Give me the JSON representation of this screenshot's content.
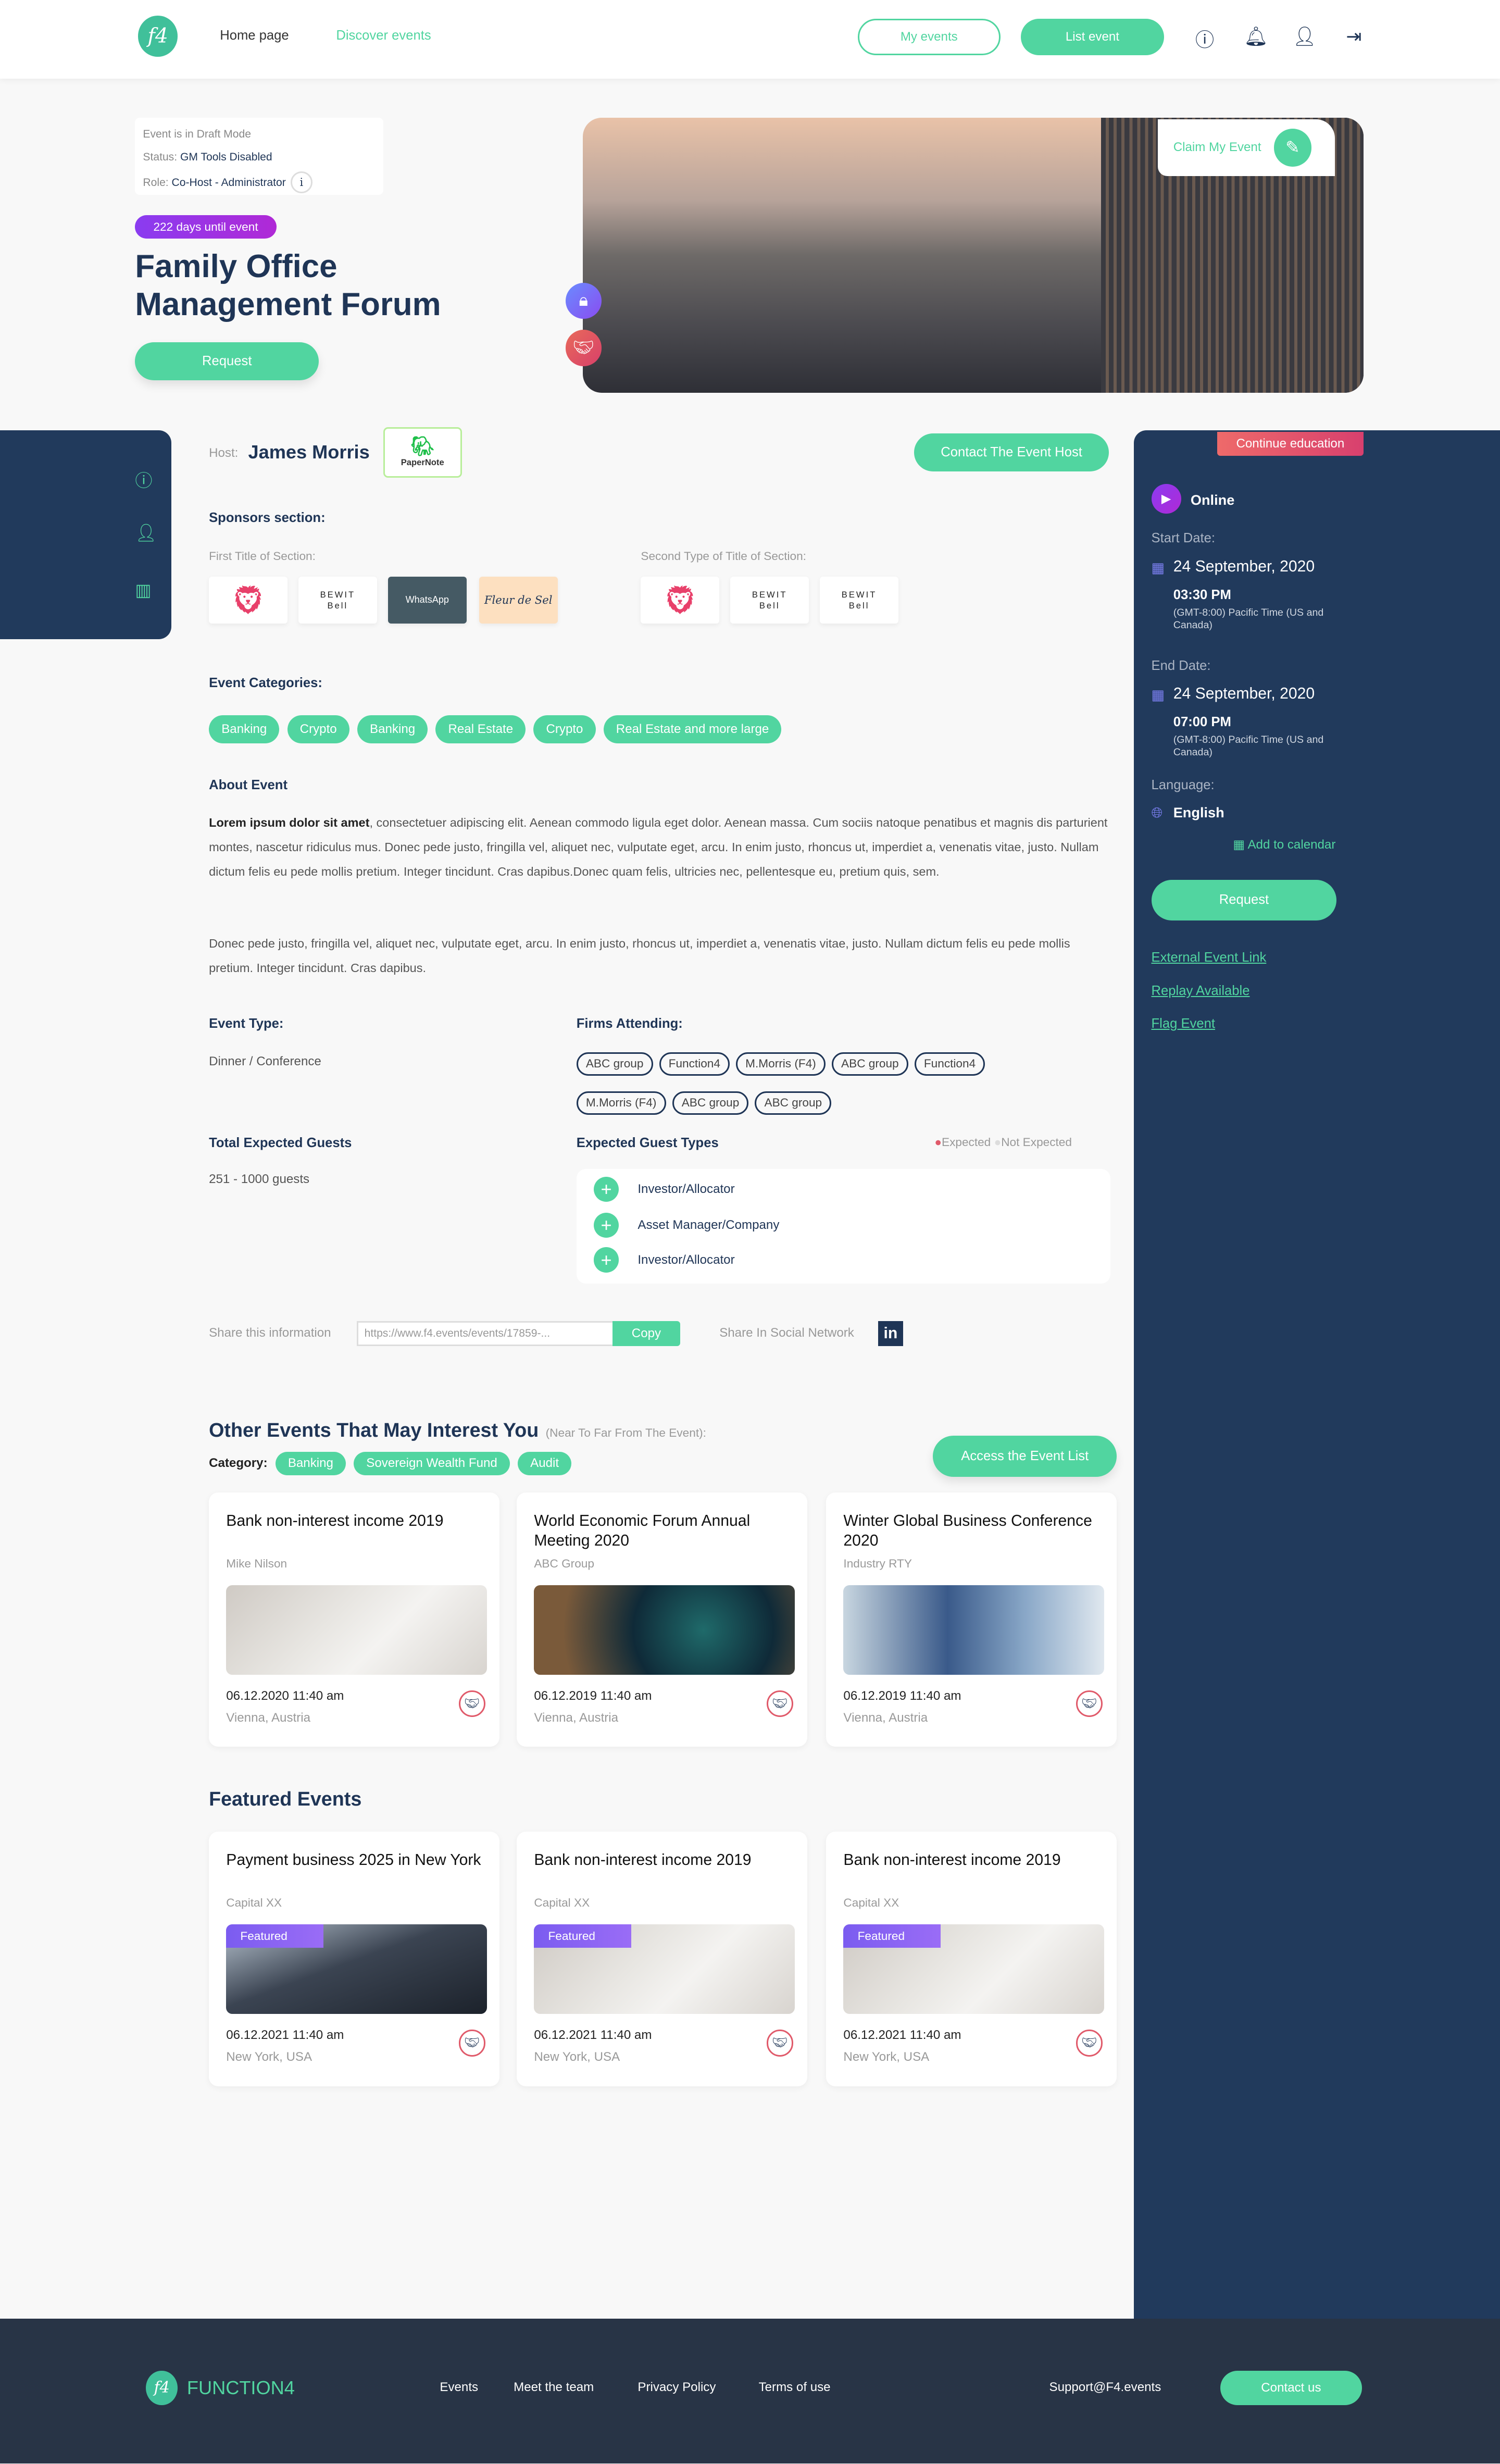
{
  "header": {
    "logo": "f4",
    "nav": [
      "Home page",
      "Discover events"
    ],
    "my_events": "My events",
    "list_event": "List event",
    "icons": [
      "info-icon",
      "bell-icon",
      "user-icon",
      "logout-icon"
    ]
  },
  "status": {
    "mode": "Event is in Draft Mode",
    "status_label": "Status:",
    "status_value": "GM Tools Disabled",
    "role_label": "Role:",
    "role_value": "Co-Host - Administrator",
    "info": "i"
  },
  "event": {
    "countdown": "222 days until event",
    "title_line1": "Family Office",
    "title_line2": "Management Forum",
    "request": "Request",
    "claim": "Claim My Event"
  },
  "host": {
    "label": "Host:",
    "name": "James Morris",
    "logo_text": "PaperNote",
    "contact": "Contact The Event Host"
  },
  "sponsors": {
    "title": "Sponsors section:",
    "first_title": "First Title of Section:",
    "second_title": "Second Type of Title of Section:",
    "first": [
      "Lion",
      "BEWIT Bell",
      "WhatsApp",
      "Fleur de Sel"
    ],
    "second": [
      "Lion",
      "BEWIT Bell",
      "BEWIT Bell"
    ]
  },
  "categories": {
    "title": "Event Categories:",
    "items": [
      "Banking",
      "Crypto",
      "Banking",
      "Real Estate",
      "Crypto",
      "Real Estate and more large"
    ]
  },
  "about": {
    "title": "About Event",
    "bold": "Lorem ipsum dolor sit amet",
    "p1": ", consectetuer adipiscing elit. Aenean commodo ligula eget dolor. Aenean massa. Cum sociis natoque penatibus et magnis dis parturient montes, nascetur ridiculus mus. Donec pede justo, fringilla vel, aliquet nec, vulputate eget, arcu. In enim justo, rhoncus ut, imperdiet a, venenatis vitae, justo. Nullam dictum felis eu pede mollis pretium. Integer tincidunt. Cras dapibus.Donec quam felis, ultricies nec, pellentesque eu, pretium quis, sem.",
    "p2": "Donec pede justo, fringilla vel, aliquet nec, vulputate eget, arcu. In enim justo, rhoncus ut, imperdiet a, venenatis vitae, justo. Nullam dictum felis eu pede mollis pretium. Integer tincidunt. Cras dapibus."
  },
  "details": {
    "type_title": "Event Type:",
    "type_value": "Dinner / Conference",
    "firms_title": "Firms Attending:",
    "firms": [
      "ABC group",
      "Function4",
      "M.Morris (F4)",
      "ABC group",
      "Function4",
      "M.Morris (F4)",
      "ABC group",
      "ABC group"
    ],
    "guests_title": "Total Expected Guests",
    "guests_value": "251 - 1000 guests",
    "types_title": "Expected Guest Types",
    "legend_expected": "Expected",
    "legend_not": "Not Expected",
    "types": [
      "Investor/Allocator",
      "Asset Manager/Company",
      "Investor/Allocator"
    ]
  },
  "share": {
    "label": "Share this information",
    "url": "https://www.f4.events/events/17859-...",
    "copy": "Copy",
    "social": "Share In Social Network",
    "linkedin": "in"
  },
  "other": {
    "title": "Other Events That May Interest You",
    "subtitle": "(Near To Far From The Event):",
    "category_label": "Category:",
    "chips": [
      "Banking",
      "Sovereign Wealth Fund",
      "Audit"
    ],
    "access": "Access the Event List",
    "cards": [
      {
        "title": "Bank non-interest income 2019",
        "sub": "Mike Nilson",
        "date": "06.12.2020 11:40 am",
        "loc": "Vienna, Austria"
      },
      {
        "title": "World Economic Forum Annual Meeting 2020",
        "sub": "ABC Group",
        "date": "06.12.2019 11:40 am",
        "loc": "Vienna, Austria"
      },
      {
        "title": "Winter Global Business Conference 2020",
        "sub": "Industry RTY",
        "date": "06.12.2019 11:40 am",
        "loc": "Vienna, Austria"
      }
    ]
  },
  "featured": {
    "title": "Featured Events",
    "tag": "Featured",
    "cards": [
      {
        "title": "Payment business 2025 in New York",
        "sub": "Capital XX",
        "date": "06.12.2021 11:40 am",
        "loc": "New York, USA"
      },
      {
        "title": "Bank non-interest income 2019",
        "sub": "Capital XX",
        "date": "06.12.2021 11:40 am",
        "loc": "New York, USA"
      },
      {
        "title": "Bank non-interest income 2019",
        "sub": "Capital XX",
        "date": "06.12.2021 11:40 am",
        "loc": "New York, USA"
      }
    ]
  },
  "panel": {
    "tag": "Continue education",
    "mode": "Online",
    "start_label": "Start Date:",
    "start_date": "24 September, 2020",
    "start_time": "03:30 PM",
    "tz": "(GMT-8:00) Pacific Time (US and Canada)",
    "end_label": "End Date:",
    "end_date": "24 September, 2020",
    "end_time": "07:00 PM",
    "lang_label": "Language:",
    "lang": "English",
    "calendar": "Add to calendar",
    "request": "Request",
    "links": [
      "External Event Link",
      "Replay Available",
      "Flag Event"
    ]
  },
  "footer": {
    "brand": "FUNCTION4",
    "links": [
      "Events",
      "Meet the team",
      "Privacy Policy",
      "Terms of use"
    ],
    "support": "Support@F4.events",
    "contact": "Contact us"
  },
  "colors": {
    "accent": "#51d5a0",
    "navy": "#213a5c",
    "footer": "#283446",
    "purple": "#8a3cf0",
    "red": "#e05a6a"
  }
}
